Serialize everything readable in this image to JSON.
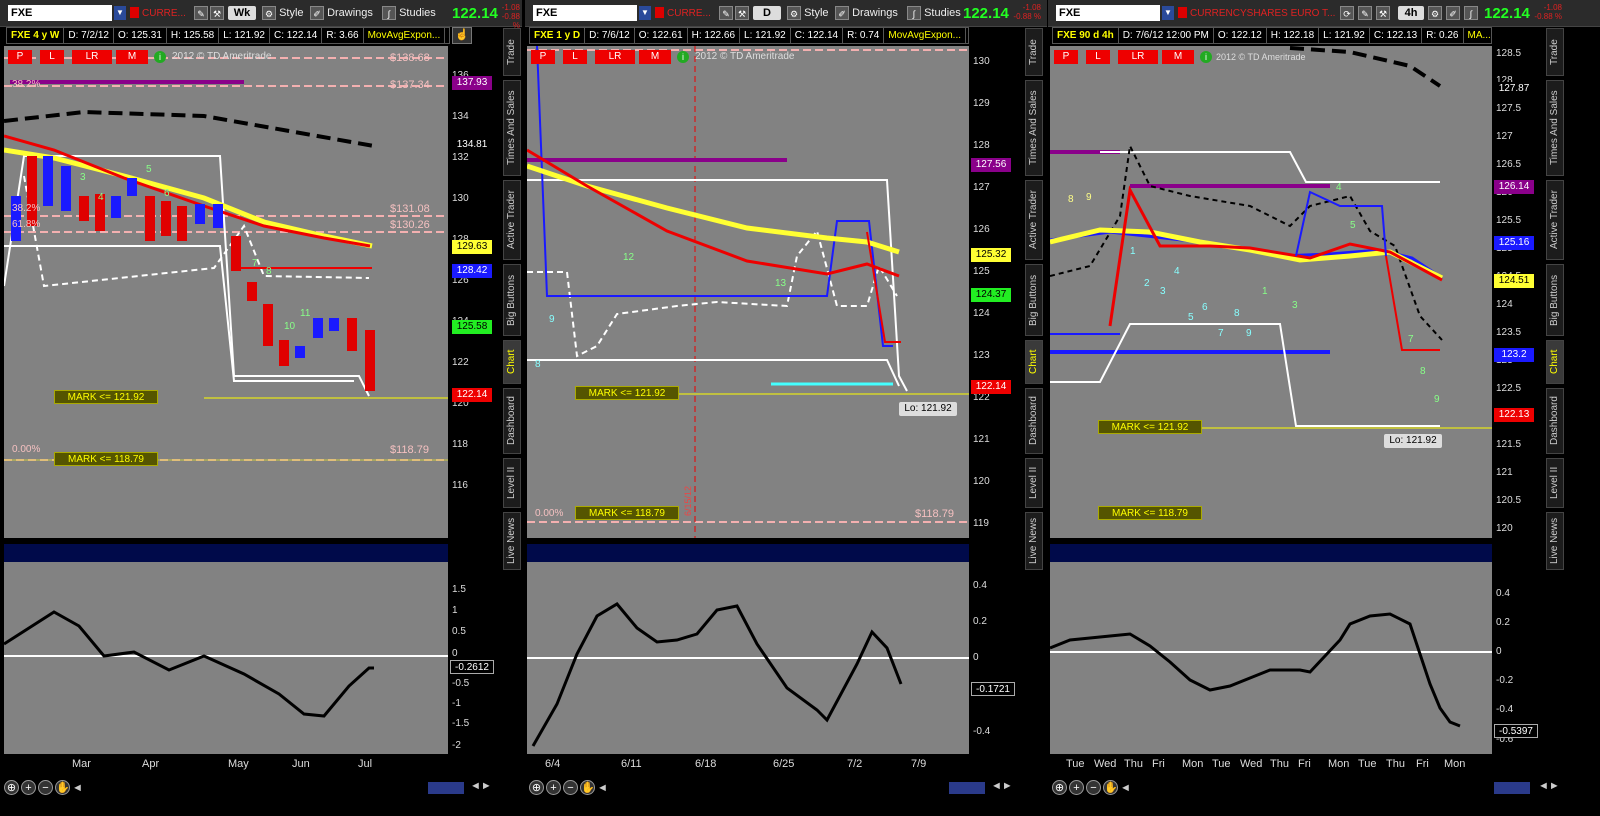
{
  "panels": [
    {
      "symbol": "FXE",
      "description": "CURRE...",
      "aggregation": "Wk",
      "style": "Style",
      "drawings": "Drawings",
      "studies": "Studies",
      "last": "122.14",
      "change": "-1.08",
      "change_pct": "-0.88 %",
      "info": {
        "title": "FXE 4 y W",
        "d": "D: 7/2/12",
        "o": "O: 125.31",
        "h": "H: 125.58",
        "l": "L: 121.92",
        "c": "C: 122.14",
        "r": "R: 3.66",
        "mav": "MovAvgExpon..."
      },
      "copyright": "2012 © TD Ameritrade",
      "xlabels": [
        "Mar",
        "Apr",
        "May",
        "Jun",
        "Jul"
      ],
      "ylabels": [
        "136",
        "134",
        "132",
        "130",
        "128",
        "126",
        "124",
        "122",
        "120",
        "118",
        "116"
      ],
      "tags": [
        "137.93",
        "134.81",
        "129.63",
        "128.42",
        "125.58",
        "122.14"
      ],
      "fib_labels": [
        "$138.68",
        "$137.34",
        "$131.08",
        "$130.26",
        "$118.79",
        "38.2%",
        "38.2%",
        "61.8%",
        "0.00%"
      ],
      "marks": [
        "MARK <= 121.92",
        "MARK <= 118.79"
      ],
      "bars": [
        "3",
        "4",
        "5",
        "6",
        "7",
        "8",
        "9",
        "10",
        "11"
      ],
      "osc_labels": [
        "1.5",
        "1",
        "0.5",
        "0",
        "-0.5",
        "-1",
        "-1.5",
        "-2"
      ],
      "osc_value": "-0.2612"
    },
    {
      "symbol": "FXE",
      "description": "CURRE...",
      "aggregation": "D",
      "style": "Style",
      "drawings": "Drawings",
      "studies": "Studies",
      "last": "122.14",
      "change": "-1.08",
      "change_pct": "-0.88 %",
      "info": {
        "title": "FXE 1 y D",
        "d": "D: 7/6/12",
        "o": "O: 122.61",
        "h": "H: 122.66",
        "l": "L: 121.92",
        "c": "C: 122.14",
        "r": "R: 0.74",
        "mav": "MovAvgExpon..."
      },
      "copyright": "2012 © TD Ameritrade",
      "xlabels": [
        "6/4",
        "6/11",
        "6/18",
        "6/25",
        "7/2",
        "7/9"
      ],
      "ylabels": [
        "130",
        "129",
        "128",
        "127",
        "126",
        "125",
        "124",
        "123",
        "122",
        "121",
        "120",
        "119"
      ],
      "tags": [
        "127.56",
        "125.32",
        "124.37",
        "122.14"
      ],
      "fib_labels": [
        "$118.79",
        "0.00%"
      ],
      "marks": [
        "MARK <= 121.92",
        "MARK <= 118.79"
      ],
      "lo": "Lo: 121.92",
      "vdate": "6/15/12",
      "bars": [
        "8",
        "9",
        "12",
        "13"
      ],
      "osc_labels": [
        "0.4",
        "0.2",
        "0",
        "-0.2",
        "-0.4"
      ],
      "osc_value": "-0.1721"
    },
    {
      "symbol": "FXE",
      "description": "CURRENCYSHARES EURO T...",
      "aggregation": "4h",
      "style": "",
      "drawings": "",
      "studies": "",
      "last": "122.14",
      "change": "-1.08",
      "change_pct": "-0.88 %",
      "info": {
        "title": "FXE 90 d 4h",
        "d": "D: 7/6/12 12:00 PM",
        "o": "O: 122.12",
        "h": "H: 122.18",
        "l": "L: 121.92",
        "c": "C: 122.13",
        "r": "R: 0.26",
        "mav": "MA..."
      },
      "copyright": "2012 © TD Ameritrade",
      "xlabels": [
        "Tue",
        "Wed",
        "Thu",
        "Fri",
        "Mon",
        "Tue",
        "Wed",
        "Thu",
        "Fri",
        "Mon",
        "Tue",
        "Thu",
        "Fri",
        "Mon"
      ],
      "ylabels": [
        "128.5",
        "128",
        "127.5",
        "127",
        "126.5",
        "126",
        "125.5",
        "125",
        "124.5",
        "124",
        "123.5",
        "123",
        "122.5",
        "122",
        "121.5",
        "121",
        "120.5",
        "120"
      ],
      "tags": [
        "127.87",
        "126.14",
        "125.16",
        "124.51",
        "123.2",
        "122.13"
      ],
      "marks": [
        "MARK <= 121.92",
        "MARK <= 118.79"
      ],
      "lo": "Lo: 121.92",
      "bars": [
        "8",
        "9",
        "1",
        "2",
        "3",
        "4",
        "5",
        "6",
        "7",
        "8",
        "9",
        "1",
        "2",
        "3",
        "4",
        "5",
        "6",
        "7",
        "8",
        "9"
      ],
      "osc_labels": [
        "0.4",
        "0.2",
        "0",
        "-0.2",
        "-0.4",
        "-0.6"
      ],
      "osc_value": "-0.5397"
    }
  ],
  "side_tabs": [
    "Trade",
    "Times And Sales",
    "Active Trader",
    "Big Buttons",
    "Chart",
    "Dashboard",
    "Level II",
    "Live News"
  ],
  "side_tabs_active": "Chart",
  "plr": [
    "P",
    "L",
    "LR",
    "M"
  ],
  "colors": {
    "up": "#1a1aff",
    "down": "#e00000",
    "ma_fast": "#ff2020",
    "ma_slow": "#ffff33",
    "price_green": "#22ff22",
    "mark_bg": "#555500"
  }
}
